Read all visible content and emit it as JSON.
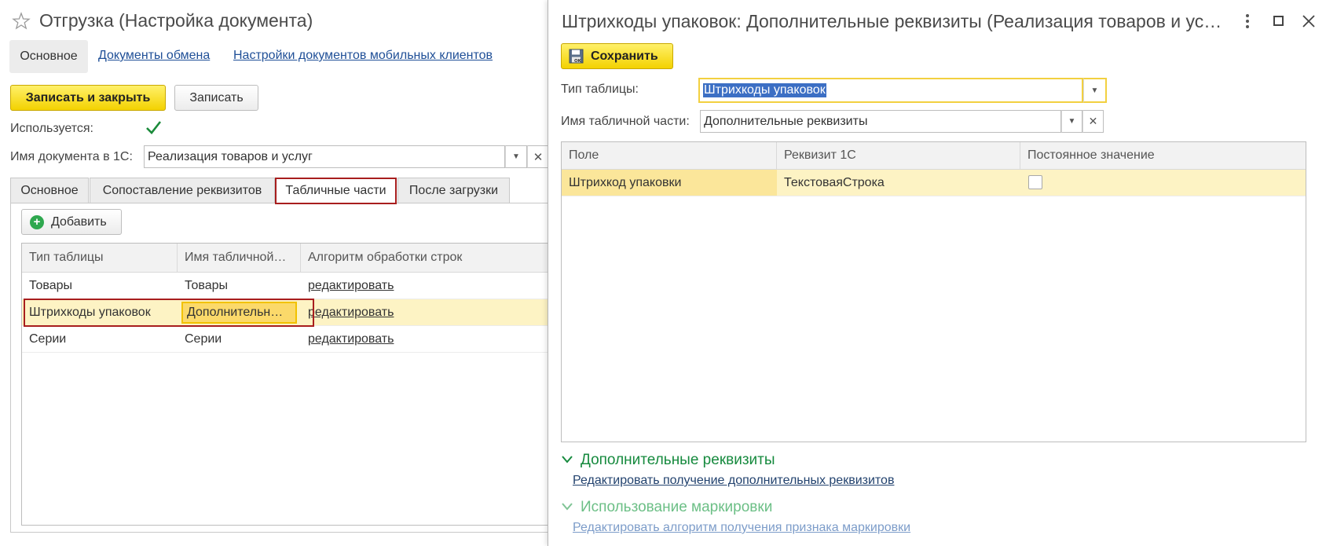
{
  "left_form": {
    "title": "Отгрузка (Настройка документа)",
    "nav": {
      "main": "Основное",
      "exchange_docs": "Документы обмена",
      "mobile_settings": "Настройки документов мобильных клиентов"
    },
    "toolbar": {
      "save_close": "Записать и закрыть",
      "save": "Записать"
    },
    "used_label": "Используется:",
    "used_checked": true,
    "doc_name_label": "Имя документа в 1С:",
    "doc_name_value": "Реализация товаров и услуг",
    "tabs": [
      "Основное",
      "Сопоставление реквизитов",
      "Табличные части",
      "После загрузки"
    ],
    "active_tab": "Табличные части",
    "add_button": "Добавить",
    "table": {
      "columns": [
        "Тип таблицы",
        "Имя табличной…",
        "Алгоритм обработки строк"
      ],
      "rows": [
        [
          "Товары",
          "Товары",
          "редактировать"
        ],
        [
          "Штрихкоды упаковок",
          "Дополнительн…",
          "редактировать"
        ],
        [
          "Серии",
          "Серии",
          "редактировать"
        ]
      ]
    }
  },
  "dialog": {
    "title": "Штрихкоды упаковок: Дополнительные реквизиты (Реализация товаров и ус…",
    "save_button": "Сохранить",
    "table_type_label": "Тип таблицы:",
    "table_type_value": "Штрихкоды упаковок",
    "part_name_label": "Имя табличной части:",
    "part_name_value": "Дополнительные реквизиты",
    "grid": {
      "columns": [
        "Поле",
        "Реквизит 1С",
        "Постоянное значение"
      ],
      "rows": [
        [
          "Штрихкод упаковки",
          "ТекстоваяСтрока",
          ""
        ]
      ]
    },
    "section1": {
      "title": "Дополнительные реквизиты",
      "link": "Редактировать получение дополнительных реквизитов"
    },
    "section2": {
      "title": "Использование маркировки",
      "link": "Редактировать алгоритм получения признака маркировки"
    }
  },
  "colors": {
    "accent_yellow": "#f5d800",
    "selection_row": "#fdf3c4",
    "highlight_red": "#a81e1e",
    "section_green": "#168a3e",
    "link_blue": "#1f4f97"
  }
}
